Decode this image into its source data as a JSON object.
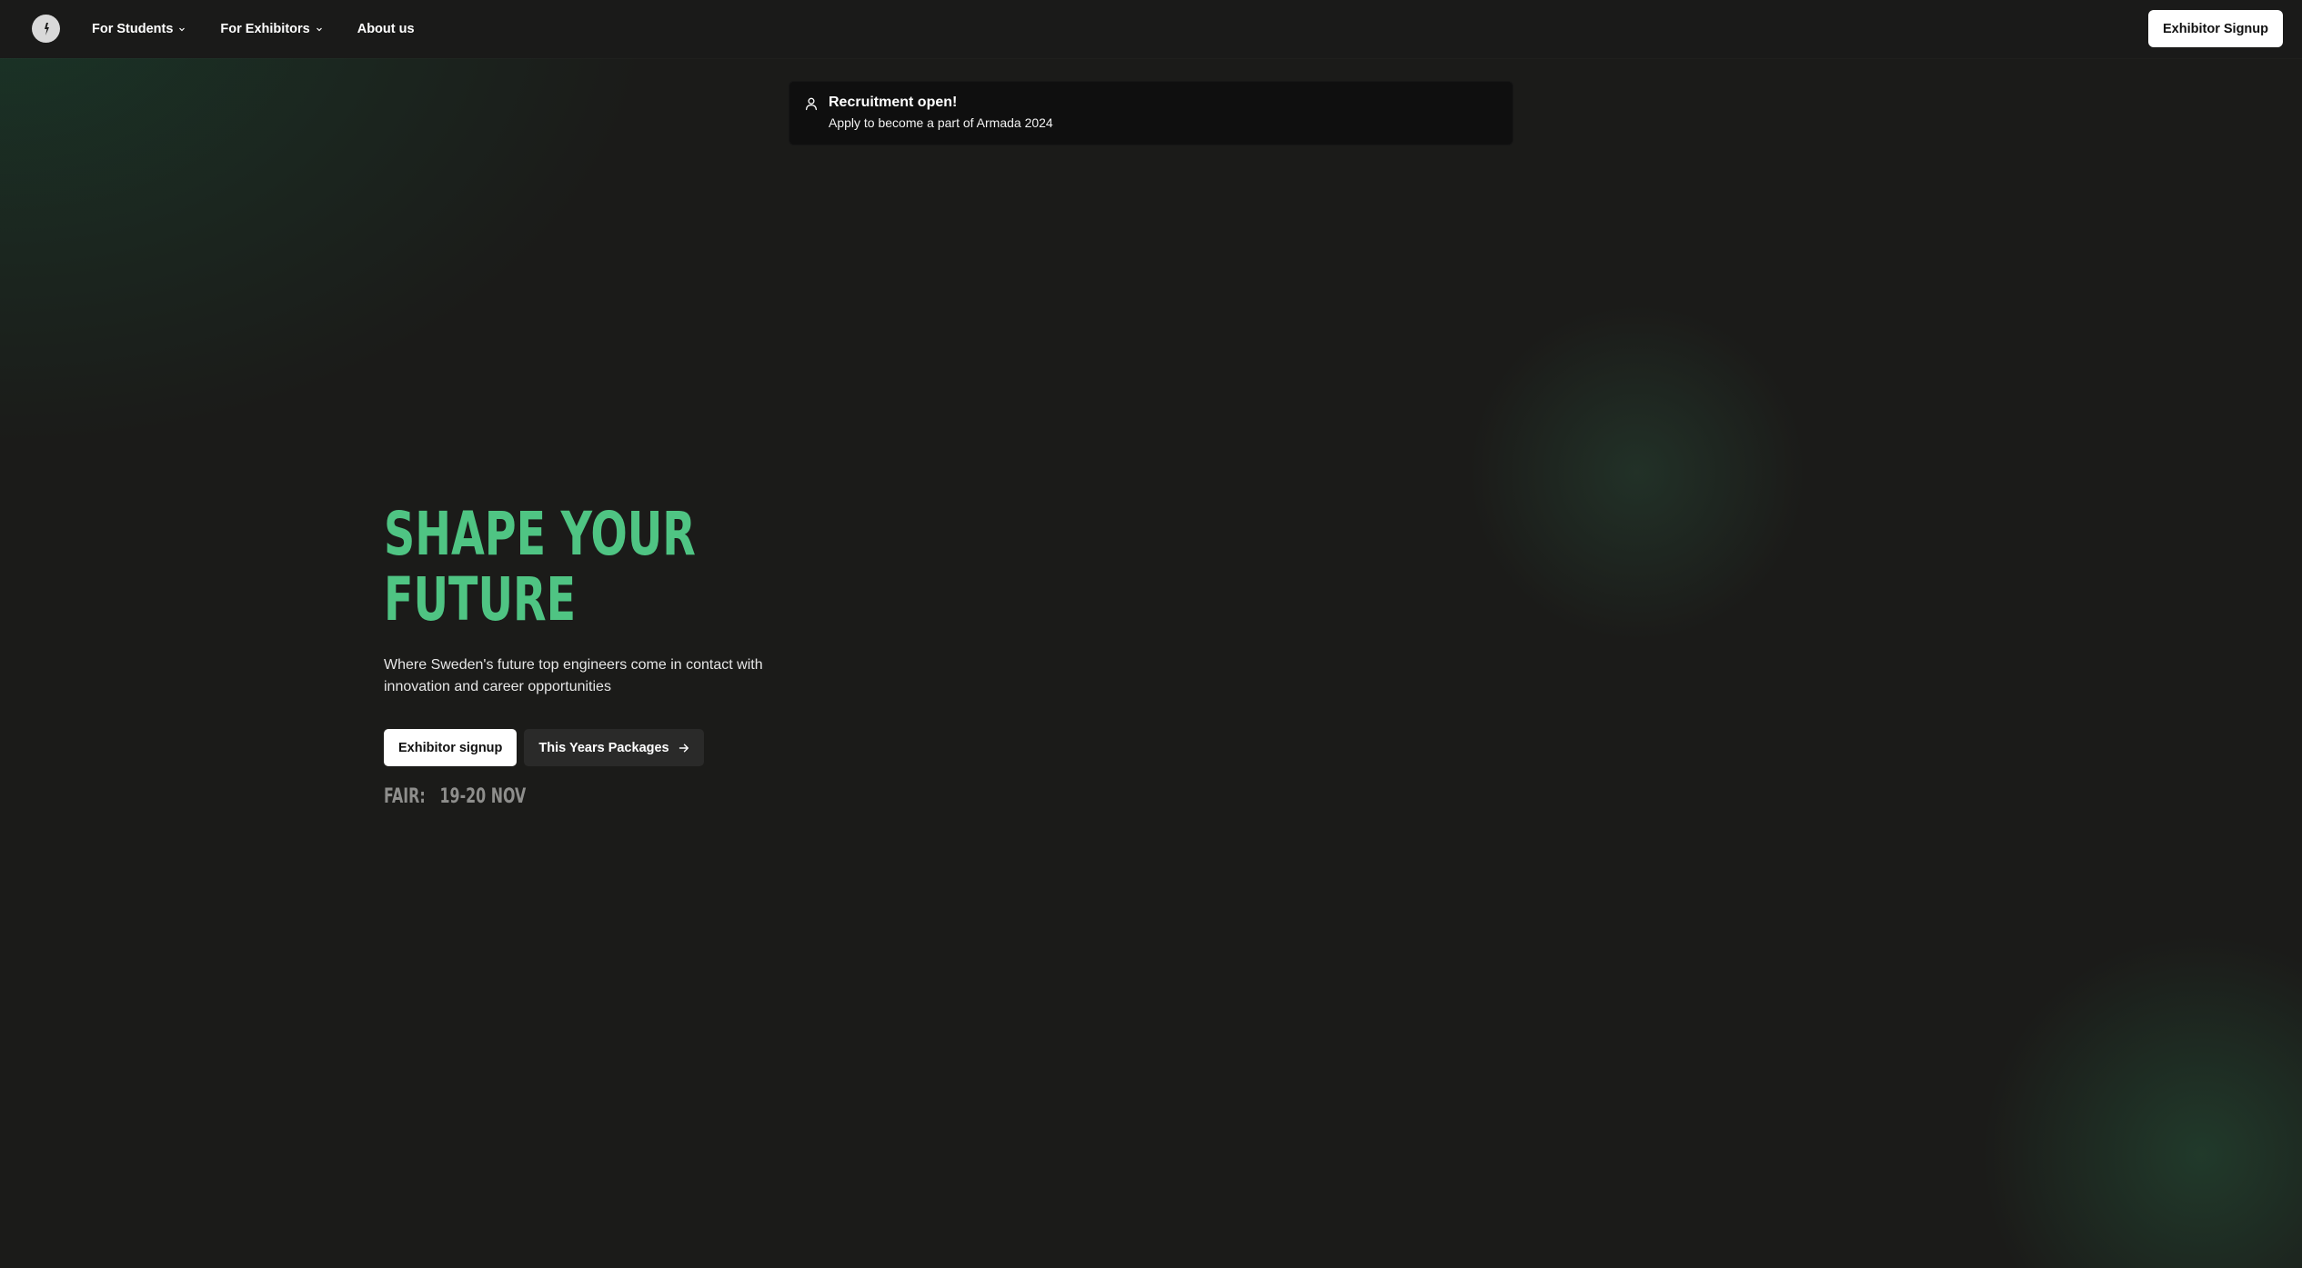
{
  "header": {
    "logo_icon": "armada-logo-icon",
    "nav": [
      {
        "label": "For Students",
        "has_dropdown": true
      },
      {
        "label": "For Exhibitors",
        "has_dropdown": true
      },
      {
        "label": "About us",
        "has_dropdown": false
      }
    ],
    "signup_label": "Exhibitor Signup"
  },
  "banner": {
    "icon": "user-icon",
    "title": "Recruitment open!",
    "subtitle": "Apply to become a part of Armada 2024"
  },
  "hero": {
    "title_line1": "SHAPE YOUR",
    "title_line2": "FUTURE",
    "description": "Where Sweden's future top engineers come in contact with innovation and career opportunities",
    "primary_button": "Exhibitor signup",
    "secondary_button": "This Years Packages",
    "fair_label": "FAIR:",
    "fair_date": "19-20 NOV"
  },
  "colors": {
    "background": "#1b1b19",
    "accent_green": "#4fc483",
    "banner_bg": "#0f0f0f",
    "button_light": "#ffffff",
    "button_dark": "#2a2a29"
  }
}
